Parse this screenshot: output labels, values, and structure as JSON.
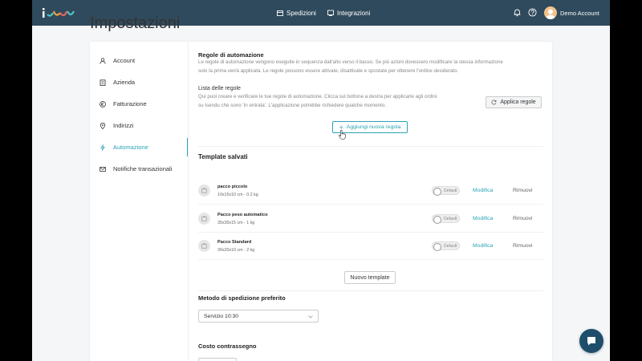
{
  "header": {
    "nav": [
      {
        "label": "Spedizioni",
        "icon": "box-icon"
      },
      {
        "label": "Integrazioni",
        "icon": "integrations-icon"
      }
    ],
    "account_name": "Demo Account"
  },
  "page_title": "Impostazioni",
  "sidebar": {
    "items": [
      {
        "label": "Account",
        "icon": "user-icon",
        "active": false
      },
      {
        "label": "Azienda",
        "icon": "building-icon",
        "active": false
      },
      {
        "label": "Fatturazione",
        "icon": "euro-icon",
        "active": false
      },
      {
        "label": "Indirizzi",
        "icon": "location-pin-icon",
        "active": false
      },
      {
        "label": "Automazione",
        "icon": "lightning-icon",
        "active": true
      },
      {
        "label": "Notifiche transazionali",
        "icon": "mail-icon",
        "active": false
      }
    ]
  },
  "automation": {
    "title": "Regole di automazione",
    "description": "Le regole di automazione vengono eseguite in sequenza dall'alto verso il basso. Se più azioni dovessero modificare la stessa informazione solo la prima verrà applicata. Le regole possono essere attivate, disattivate e spostate per ottenere l'ordine desiderato.",
    "list_title": "Lista delle regole",
    "list_description": "Qui puoi creare e verificare le tue regole di automazione. Clicca sul bottone a destra per applicarle agli ordini su Isendu che sono 'In entrata'. L'applicazione potrebbe richiedere qualche momento.",
    "apply_button": "Applica regole",
    "add_button": "Aggiungi nuova regola"
  },
  "templates": {
    "title": "Template salvati",
    "items": [
      {
        "name": "pacco piccolo",
        "dims": "10x15x10 cm - 0.2 kg",
        "toggle_label": "Default",
        "is_default": false,
        "edit_label": "Modifica",
        "remove_label": "Rimuovi"
      },
      {
        "name": "Pacco peso automatico",
        "dims": "35x35x15 cm - 1 kg",
        "toggle_label": "Default",
        "is_default": false,
        "edit_label": "Modifica",
        "remove_label": "Rimuovi"
      },
      {
        "name": "Pacco Standard",
        "dims": "30x20x10 cm - 2 kg",
        "toggle_label": "Default",
        "is_default": false,
        "edit_label": "Modifica",
        "remove_label": "Rimuovi"
      }
    ],
    "new_button": "Nuovo template"
  },
  "shipping": {
    "title": "Metodo di spedizione preferito",
    "selected": "Servizio 10:30"
  },
  "cod": {
    "title": "Costo contrassegno",
    "value": ""
  },
  "colors": {
    "header_bg": "#2f4a5c",
    "accent": "#2aa3b5",
    "chat_bg": "#1f4e6b"
  }
}
